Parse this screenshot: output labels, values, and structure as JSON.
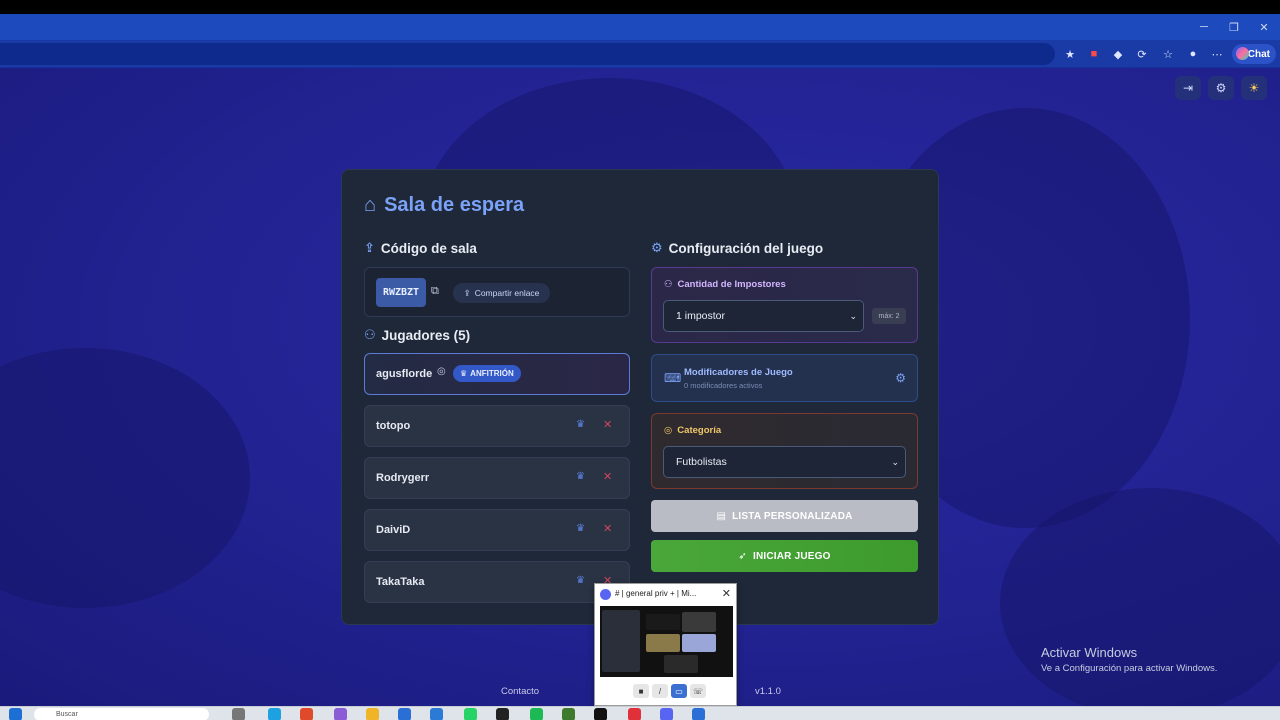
{
  "browser": {
    "chat_label": "Chat",
    "window_controls": [
      "minimize-icon",
      "restore-icon",
      "close-icon"
    ],
    "toolbar_icons": [
      "star-icon",
      "extension-red-icon",
      "extension-diamond-icon",
      "extension-puzzle-icon",
      "favorites-icon",
      "profile-icon",
      "more-icon"
    ]
  },
  "app": {
    "header_icons": [
      "logout-icon",
      "settings-icon",
      "theme-sun-icon"
    ],
    "waiting_room": {
      "title": "Sala de espera",
      "room_code_heading": "Código de sala",
      "room_code": "RWZBZT",
      "share_label": "Compartir enlace",
      "players_heading": "Jugadores (5)",
      "host_badge": "ANFITRIÓN",
      "players": [
        {
          "name": "agusflorde",
          "host": true
        },
        {
          "name": "totopo",
          "host": false
        },
        {
          "name": "Rodrygerr",
          "host": false
        },
        {
          "name": "DaiviD",
          "host": false
        },
        {
          "name": "TakaTaka",
          "host": false
        }
      ]
    },
    "config": {
      "heading": "Configuración del juego",
      "impostors_label": "Cantidad de Impostores",
      "impostors_value": "1 impostor",
      "impostors_max": "máx: 2",
      "modifiers_label": "Modificadores de Juego",
      "modifiers_sub": "0 modificadores activos",
      "category_label": "Categoría",
      "category_value": "Futbolistas",
      "custom_list_button": "LISTA PERSONALIZADA",
      "start_button": "INICIAR JUEGO"
    },
    "footer": {
      "contact": "Contacto",
      "version": "v1.1.0"
    }
  },
  "colors": {
    "accent": "#7aa2f7",
    "background": "#21218f",
    "card": "#1f2838",
    "start_green": "#45a234",
    "danger": "#d0455a"
  },
  "overlay": {
    "discord_popup_title": "# | general priv + | Mi...",
    "windows_watermark_title": "Activar Windows",
    "windows_watermark_sub": "Ve a Configuración para activar Windows."
  },
  "taskbar": {
    "search_placeholder": "Buscar"
  }
}
